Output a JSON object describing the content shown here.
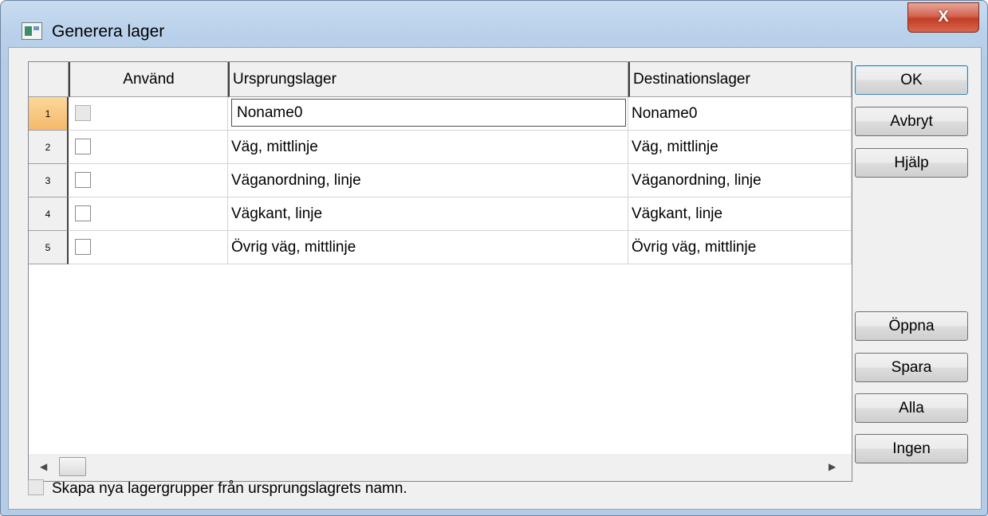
{
  "window": {
    "title": "Generera lager",
    "close_label": "X"
  },
  "grid": {
    "columns": [
      "Använd",
      "Ursprungslager",
      "Destinationslager"
    ],
    "rows": [
      {
        "num": "1",
        "anvand": false,
        "ursprung": "Noname0",
        "destination": "Noname0"
      },
      {
        "num": "2",
        "anvand": false,
        "ursprung": "Väg, mittlinje",
        "destination": "Väg, mittlinje"
      },
      {
        "num": "3",
        "anvand": false,
        "ursprung": "Väganordning, linje",
        "destination": "Väganordning, linje"
      },
      {
        "num": "4",
        "anvand": false,
        "ursprung": "Vägkant, linje",
        "destination": "Vägkant, linje"
      },
      {
        "num": "5",
        "anvand": false,
        "ursprung": "Övrig väg, mittlinje",
        "destination": "Övrig väg, mittlinje"
      }
    ]
  },
  "buttons": {
    "ok": "OK",
    "avbryt": "Avbryt",
    "hjalp": "Hjälp",
    "oppna": "Öppna",
    "spara": "Spara",
    "alla": "Alla",
    "ingen": "Ingen"
  },
  "footer": {
    "checkbox_label": "Skapa nya lagergrupper från ursprungslagrets namn.",
    "checked": false
  },
  "icons": {
    "window": "layers-app-icon",
    "scroll_left": "scroll-left-arrow-icon",
    "scroll_right": "scroll-right-arrow-icon"
  }
}
